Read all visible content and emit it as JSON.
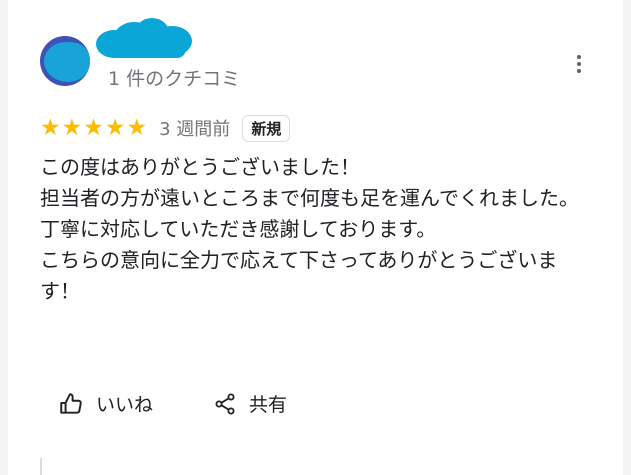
{
  "review": {
    "review_count": "1 件のクチコミ",
    "rating": 5,
    "stars": [
      "★",
      "★",
      "★",
      "★",
      "★"
    ],
    "time": "3 週間前",
    "badge": "新規",
    "text": "この度はありがとうございました！\n担当者の方が遠いところまで何度も足を運んでくれました。\n丁寧に対応していただき感謝しております。\nこちらの意向に全力で応えて下さってありがとうございます！"
  },
  "actions": {
    "like_label": "いいね",
    "share_label": "共有"
  },
  "icons": {
    "more": "more-vert-icon",
    "like": "thumb-up-icon",
    "share": "share-icon"
  },
  "colors": {
    "star": "#fbbc04",
    "avatar_bg": "#3f51b5",
    "avatar_fg": "#1aa3d6",
    "name_blur": "#0aa6d8"
  }
}
